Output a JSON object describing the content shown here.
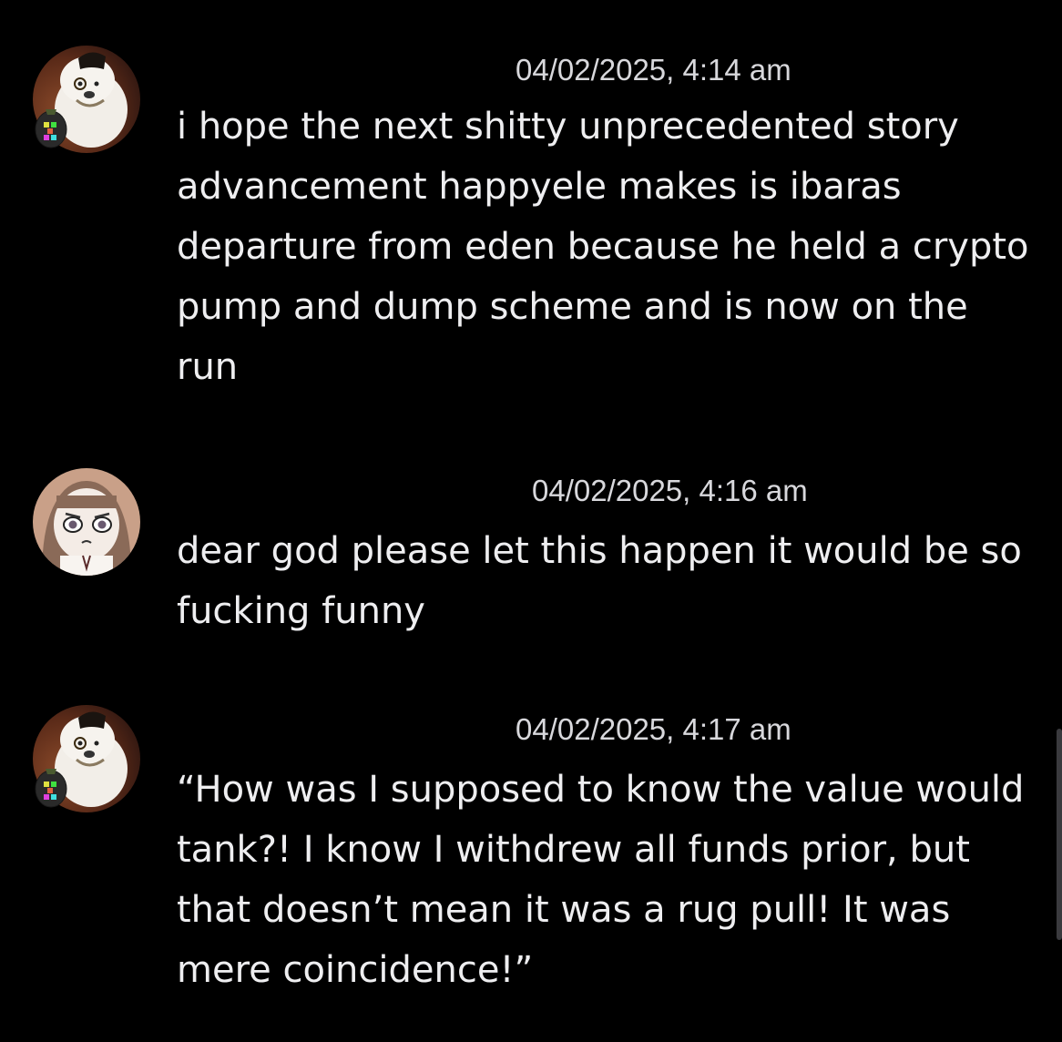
{
  "messages": [
    {
      "username": "",
      "timestamp": "04/02/2025, 4:14 am",
      "text": "i hope the next shitty unprecedented story advancement happyele makes is ibaras departure from eden because he held a crypto pump and dump scheme and is now on the run",
      "avatar_icon": "fluffy-dog-with-monocle-avatar"
    },
    {
      "username": "",
      "timestamp": "04/02/2025, 4:16 am",
      "text": "dear god please let this happen it would be so fucking funny",
      "avatar_icon": "anime-girl-avatar"
    },
    {
      "username": "",
      "timestamp": "04/02/2025, 4:17 am",
      "text": "“How was I supposed to know the value would tank?! I know I withdrew all funds prior, but that doesn’t mean it was a rug pull! It was mere coincidence!”",
      "avatar_icon": "fluffy-dog-with-monocle-avatar"
    }
  ],
  "colors": {
    "background": "#000000",
    "text": "#eeeef0",
    "timestamp": "#d8d8dc"
  }
}
